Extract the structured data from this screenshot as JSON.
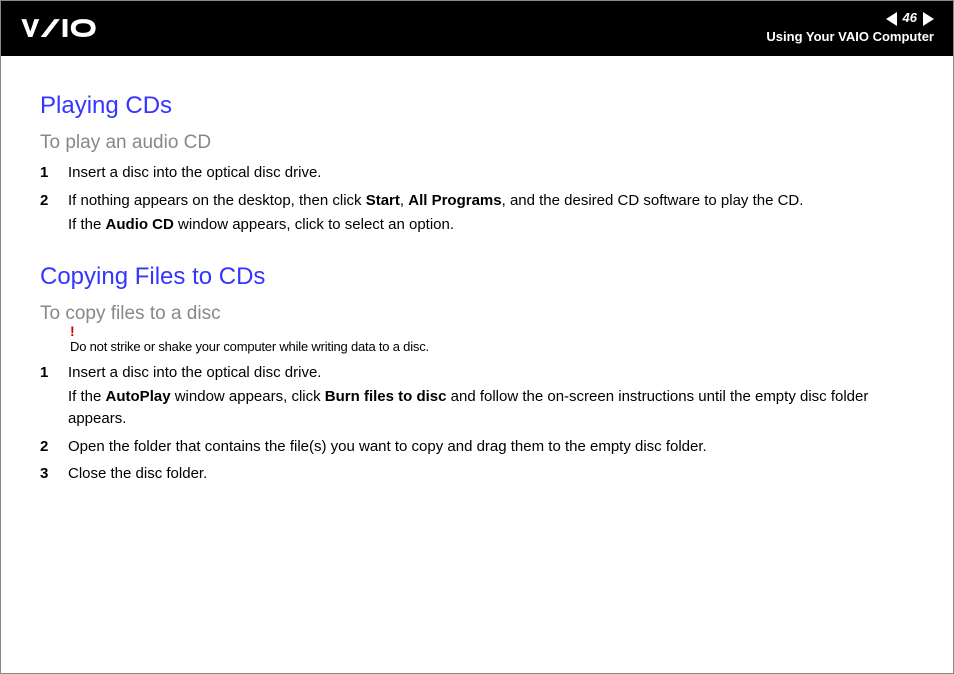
{
  "header": {
    "page_number": "46",
    "subtitle": "Using Your VAIO Computer"
  },
  "section1": {
    "heading": "Playing CDs",
    "subheading": "To play an audio CD",
    "steps": {
      "s1": {
        "num": "1",
        "text": "Insert a disc into the optical disc drive."
      },
      "s2": {
        "num": "2",
        "pre": "If nothing appears on the desktop, then click ",
        "b1": "Start",
        "mid1": ", ",
        "b2": "All Programs",
        "post": ", and the desired CD software to play the CD.",
        "line2_pre": "If the ",
        "line2_b": "Audio CD",
        "line2_post": " window appears, click to select an option."
      }
    }
  },
  "section2": {
    "heading": "Copying Files to CDs",
    "subheading": "To copy files to a disc",
    "caution": {
      "mark": "!",
      "text": "Do not strike or shake your computer while writing data to a disc."
    },
    "steps": {
      "s1": {
        "num": "1",
        "line1": "Insert a disc into the optical disc drive.",
        "line2_pre": "If the ",
        "line2_b1": "AutoPlay",
        "line2_mid": " window appears, click ",
        "line2_b2": "Burn files to disc",
        "line2_post": " and follow the on-screen instructions until the empty disc folder appears."
      },
      "s2": {
        "num": "2",
        "text": "Open the folder that contains the file(s) you want to copy and drag them to the empty disc folder."
      },
      "s3": {
        "num": "3",
        "text": "Close the disc folder."
      }
    }
  }
}
